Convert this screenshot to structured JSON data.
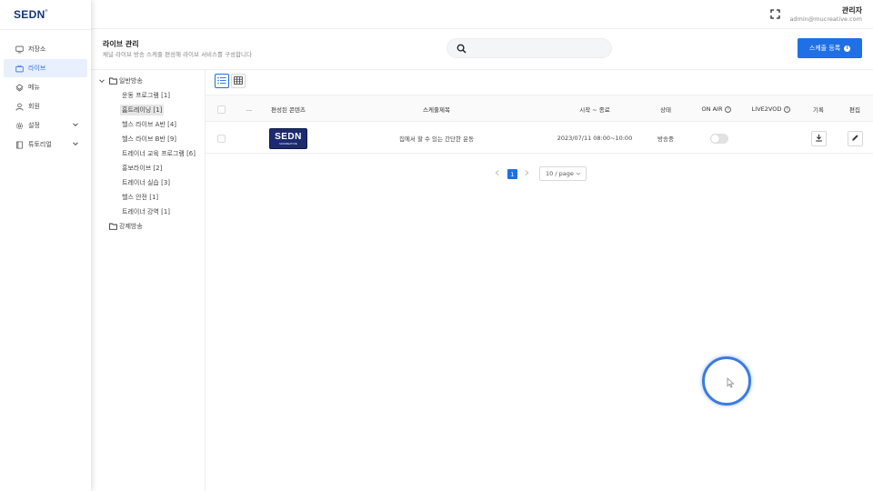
{
  "app": {
    "logo": "SEDN",
    "logo_mark": "®"
  },
  "sidebar": {
    "items": [
      {
        "label": "저장소",
        "icon": "monitor-icon",
        "active": false
      },
      {
        "label": "라이브",
        "icon": "live-icon",
        "active": true
      },
      {
        "label": "메뉴",
        "icon": "menu-icon",
        "active": false
      },
      {
        "label": "회원",
        "icon": "user-icon",
        "active": false
      },
      {
        "label": "설정",
        "icon": "gear-icon",
        "active": false,
        "expandable": true
      },
      {
        "label": "튜토리얼",
        "icon": "book-icon",
        "active": false,
        "expandable": true
      }
    ]
  },
  "header": {
    "user_name": "관리자",
    "user_email": "admin@mucreative.com"
  },
  "page": {
    "title": "라이브 관리",
    "description": "채널 라이브 방송 스케줄 편성해 라이브 서비스를 구성합니다",
    "search_placeholder": "",
    "add_button": "스케줄 등록",
    "add_button_icon": "i"
  },
  "tree": {
    "groups": [
      {
        "label": "일반방송",
        "expanded": true,
        "children": [
          {
            "label": "운동 프로그램 [1]",
            "selected": false
          },
          {
            "label": "홈트레이닝 [1]",
            "selected": true
          },
          {
            "label": "헬스 라이브 A반 [4]",
            "selected": false
          },
          {
            "label": "헬스 라이브 B반 [9]",
            "selected": false
          },
          {
            "label": "트레이너 교육 프로그램 [6]",
            "selected": false
          },
          {
            "label": "홍보라이브 [2]",
            "selected": false
          },
          {
            "label": "트레이너 실습 [3]",
            "selected": false
          },
          {
            "label": "헬스 안전 [1]",
            "selected": false
          },
          {
            "label": "트레이너 강역 [1]",
            "selected": false
          }
        ]
      },
      {
        "label": "강제방송",
        "expanded": false,
        "children": []
      }
    ]
  },
  "table": {
    "columns": {
      "more": "...",
      "content": "편성된 콘텐츠",
      "title": "스케줄제목",
      "time": "시작 ~ 종료",
      "status": "상태",
      "onair": "ON AIR",
      "live2vod": "LIVE2VOD",
      "record": "기록",
      "edit": "편집"
    },
    "info_glyph": "i",
    "rows": [
      {
        "thumbnail_text": "SEDN",
        "thumbnail_subtext": "MUCREATIVE",
        "title": "집에서 할 수 있는 간단한 운동",
        "time": "2023/07/11 08:00~10:00",
        "status": "방송중",
        "onair": false
      }
    ]
  },
  "pagination": {
    "current": "1",
    "page_size": "10 / page"
  },
  "colors": {
    "primary": "#1f6fe5",
    "logo": "#14357a",
    "active_bg": "#e8f0fd",
    "cursor_ring": "#3b7be0"
  }
}
